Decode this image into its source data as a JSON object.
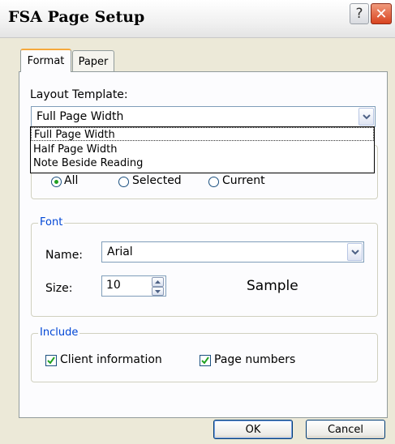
{
  "window": {
    "title": "FSA Page Setup",
    "help_label": "?",
    "close_label": "✕"
  },
  "tabs": [
    {
      "label": "Format",
      "active": true
    },
    {
      "label": "Paper",
      "active": false
    }
  ],
  "layout_template": {
    "label": "Layout Template:",
    "value": "Full Page Width",
    "options": [
      "Full Page Width",
      "Half Page Width",
      "Note Beside Reading"
    ]
  },
  "range": {
    "options": [
      {
        "label": "All",
        "selected": true
      },
      {
        "label": "Selected",
        "selected": false
      },
      {
        "label": "Current",
        "selected": false
      }
    ]
  },
  "font": {
    "group_label": "Font",
    "name_label": "Name:",
    "name_value": "Arial",
    "size_label": "Size:",
    "size_value": "10",
    "sample_label": "Sample"
  },
  "include": {
    "group_label": "Include",
    "client_info_label": "Client information",
    "client_info_checked": true,
    "page_numbers_label": "Page numbers",
    "page_numbers_checked": true
  },
  "buttons": {
    "ok_label": "OK",
    "cancel_label": "Cancel"
  },
  "colors": {
    "accent_tab": "#f6a93c",
    "group_title": "#0046d5",
    "check": "#21a121",
    "close": "#d9431f"
  }
}
